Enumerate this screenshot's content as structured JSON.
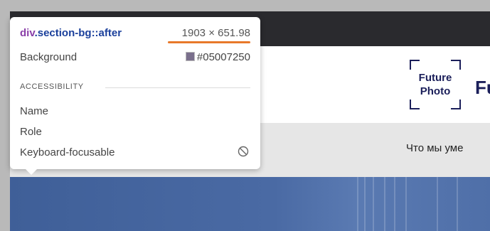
{
  "website": {
    "logo_line1": "Future",
    "logo_line2": "Photo",
    "brand_fragment": "Fu",
    "nav_item": "Что мы уме"
  },
  "inspector_tooltip": {
    "selector_tag": "div",
    "selector_class": ".section-bg::after",
    "size": "1903 × 651.98",
    "background_label": "Background",
    "background_value": "#05007250",
    "accessibility_heading": "ACCESSIBILITY",
    "name_label": "Name",
    "role_label": "Role",
    "keyboard_label": "Keyboard-focusable",
    "keyboard_icon": "not-focusable-icon"
  },
  "colors": {
    "highlight_underline": "#e8792a",
    "selector_tag": "#8a3fa8",
    "selector_class": "#1a3f9b",
    "brand": "#1b1f5a"
  }
}
